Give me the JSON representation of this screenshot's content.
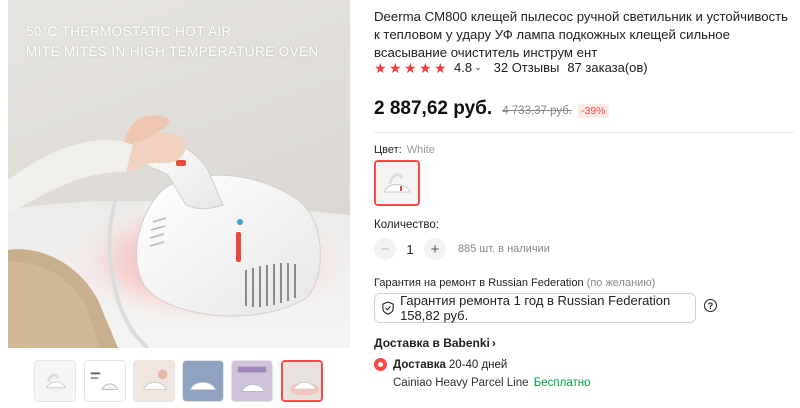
{
  "gallery": {
    "hero_caption_line1": "50°C THERMOSTATIC HOT AIR",
    "hero_caption_line2": "MITE MITES IN HIGH TEMPERATURE OVEN",
    "thumbnails": [
      "thumb-1",
      "thumb-2",
      "thumb-3",
      "thumb-4",
      "thumb-5",
      "thumb-6"
    ],
    "active_thumbnail": 6
  },
  "product": {
    "title": "Deerma CM800 клещей пылесос ручной светильник и устойчивость к тепловом у удару УФ лампа подкожных клещей сильное всасывание очиститель инструм ент",
    "rating": "4.8",
    "reviews": "32 Отзывы",
    "orders": "87 заказа(ов)",
    "price": "2 887,62 руб.",
    "old_price": "4 733,37 руб.",
    "discount": "-39%"
  },
  "options": {
    "color_label": "Цвет:",
    "color_value": "White",
    "quantity_label": "Количество:",
    "quantity": "1",
    "stock": "885 шт. в наличии",
    "minus": "−",
    "plus": "+"
  },
  "warranty": {
    "label": "Гарантия на ремонт в Russian Federation",
    "label_optional": "(по желанию)",
    "option": "Гарантия ремонта 1 год в Russian Federation 158,82 руб.",
    "help": "?"
  },
  "shipping": {
    "link": "Доставка в Babenki",
    "delivery_title": "Доставка",
    "delivery_days": "20-40 дней",
    "carrier": "Cainiao Heavy Parcel Line",
    "price": "Бесплатно"
  },
  "colors": {
    "accent": "#ff4747",
    "star": "#f33b3b",
    "free": "#00a046"
  }
}
